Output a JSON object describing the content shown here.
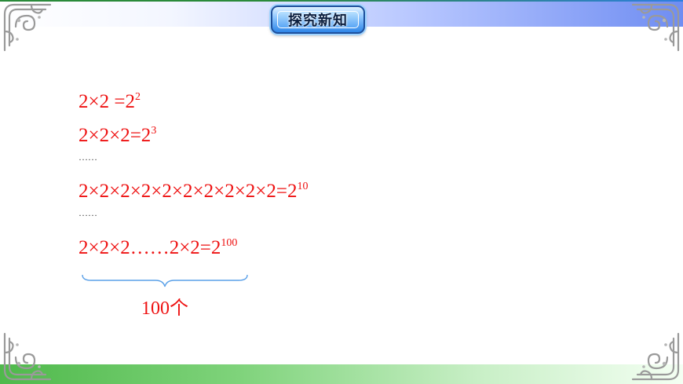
{
  "header": {
    "title": "探究新知"
  },
  "equations": [
    {
      "base": "2×2 =2",
      "exponent": "2"
    },
    {
      "base": "2×2×2=2",
      "exponent": "3"
    },
    {
      "base": "2×2×2×2×2×2×2×2×2×2=2",
      "exponent": "10"
    },
    {
      "base": "2×2×2……2×2=2",
      "exponent": "100"
    }
  ],
  "ellipsis": [
    "……",
    "……"
  ],
  "brace_label": "100个",
  "colors": {
    "math_text": "#ee1111",
    "top_band_accent": "#6f8df2",
    "bottom_band_accent": "#4fb94b",
    "badge_blue": "#2f86e8"
  },
  "icons": {
    "corner": "ornament-corner-icon",
    "brace": "underbrace-icon"
  }
}
